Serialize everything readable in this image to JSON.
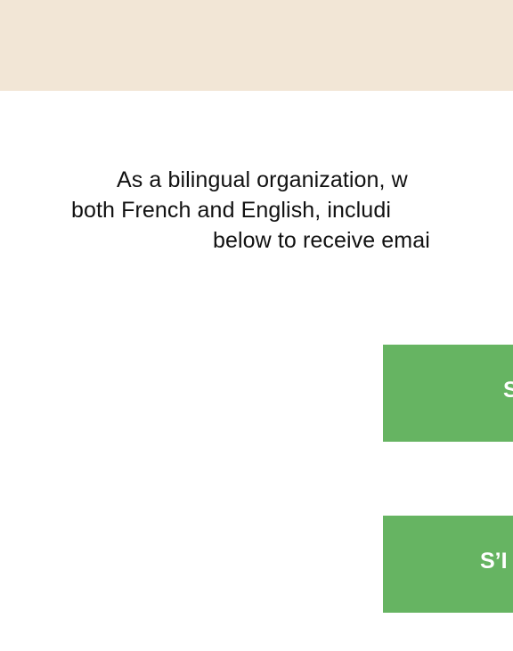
{
  "colors": {
    "top_band": "#f2e6d6",
    "button_green": "#66b462",
    "button_text": "#ffffff",
    "body_text": "#111111"
  },
  "intro": {
    "line1": "As a bilingual organization, w",
    "line2": "both French and English, includi",
    "line3": "below to receive emai"
  },
  "buttons": {
    "english_label": "S",
    "french_label": "S’I"
  }
}
